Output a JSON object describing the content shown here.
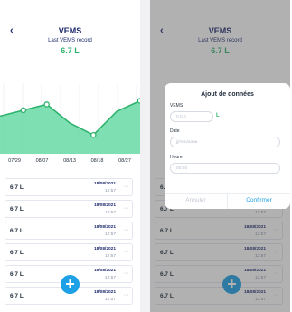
{
  "header": {
    "back_icon": "chevron-left-icon",
    "title": "VEMS",
    "subtitle": "Last VEMS record",
    "value": "6.7 L",
    "accent_green": "#2fb26c",
    "accent_blue": "#1ea0e6"
  },
  "chart_data": {
    "type": "area",
    "categories": [
      "07/29",
      "08/07",
      "08/13",
      "08/18",
      "08/27"
    ],
    "x": [
      0,
      1,
      2,
      3,
      4,
      5,
      6
    ],
    "values": [
      3.2,
      3.7,
      4.2,
      2.6,
      1.6,
      3.6,
      4.5
    ],
    "ylim": [
      0,
      6
    ],
    "grid": "vertical",
    "marker_indices": [
      1,
      2,
      4,
      6
    ],
    "title": "",
    "xlabel": "",
    "ylabel": ""
  },
  "records": [
    {
      "value": "6.7 L",
      "date": "18/08/2021",
      "time": "12:57"
    },
    {
      "value": "6.7 L",
      "date": "18/08/2021",
      "time": "12:57"
    },
    {
      "value": "6.7 L",
      "date": "18/08/2021",
      "time": "12:57"
    },
    {
      "value": "6.7 L",
      "date": "18/08/2021",
      "time": "12:57"
    },
    {
      "value": "6.7 L",
      "date": "18/08/2021",
      "time": "12:57"
    },
    {
      "value": "6.7 L",
      "date": "18/08/2021",
      "time": "12:57"
    }
  ],
  "fab": {
    "label": "+",
    "icon": "plus-icon"
  },
  "modal": {
    "title": "Ajout de données",
    "vems_label": "VEMS",
    "vems_placeholder": "0.0.0",
    "vems_unit": "L",
    "date_label": "Date",
    "date_placeholder": "jj/mm/aaaa",
    "time_label": "Heure",
    "time_placeholder": "00:00",
    "cancel_label": "Annuler",
    "confirm_label": "Confirmer"
  }
}
